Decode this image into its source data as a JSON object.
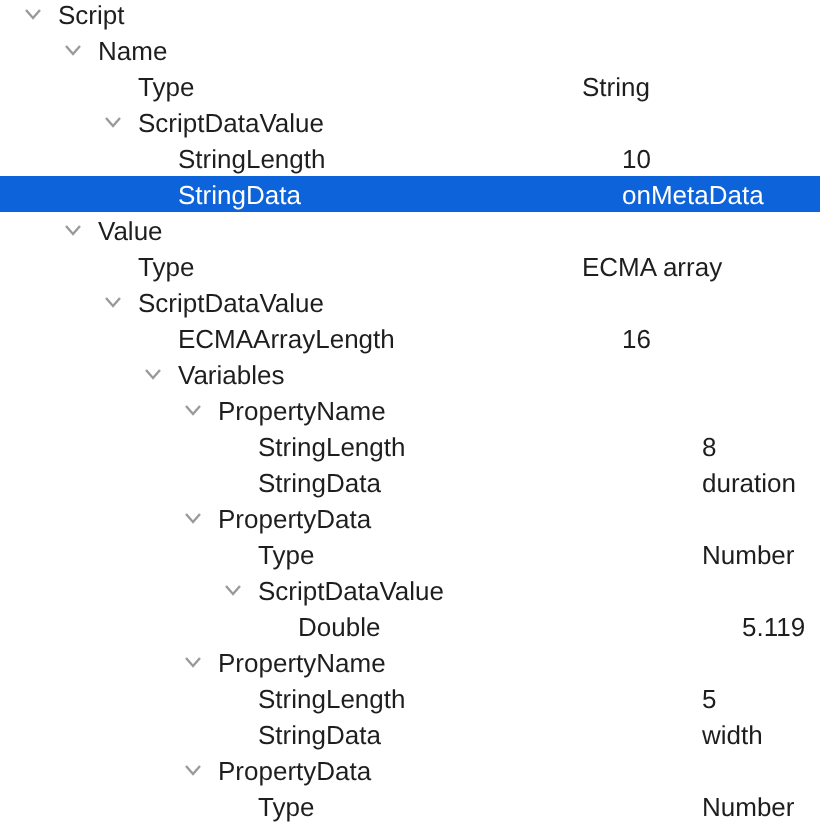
{
  "tree": [
    {
      "label": "Script",
      "expanded": true,
      "selected": false,
      "children": [
        {
          "label": "Name",
          "expanded": true,
          "selected": false,
          "children": [
            {
              "label": "Type",
              "value": "String",
              "selected": false
            },
            {
              "label": "ScriptDataValue",
              "expanded": true,
              "selected": false,
              "children": [
                {
                  "label": "StringLength",
                  "value": "10",
                  "selected": false
                },
                {
                  "label": "StringData",
                  "value": "onMetaData",
                  "selected": true
                }
              ]
            }
          ]
        },
        {
          "label": "Value",
          "expanded": true,
          "selected": false,
          "children": [
            {
              "label": "Type",
              "value": "ECMA array",
              "selected": false
            },
            {
              "label": "ScriptDataValue",
              "expanded": true,
              "selected": false,
              "children": [
                {
                  "label": "ECMAArrayLength",
                  "value": "16",
                  "selected": false
                },
                {
                  "label": "Variables",
                  "expanded": true,
                  "selected": false,
                  "children": [
                    {
                      "label": "PropertyName",
                      "expanded": true,
                      "selected": false,
                      "children": [
                        {
                          "label": "StringLength",
                          "value": "8",
                          "selected": false
                        },
                        {
                          "label": "StringData",
                          "value": "duration",
                          "selected": false
                        }
                      ]
                    },
                    {
                      "label": "PropertyData",
                      "expanded": true,
                      "selected": false,
                      "children": [
                        {
                          "label": "Type",
                          "value": "Number",
                          "selected": false
                        },
                        {
                          "label": "ScriptDataValue",
                          "expanded": true,
                          "selected": false,
                          "children": [
                            {
                              "label": "Double",
                              "value": "5.119",
                              "selected": false
                            }
                          ]
                        }
                      ]
                    },
                    {
                      "label": "PropertyName",
                      "expanded": true,
                      "selected": false,
                      "children": [
                        {
                          "label": "StringLength",
                          "value": "5",
                          "selected": false
                        },
                        {
                          "label": "StringData",
                          "value": "width",
                          "selected": false
                        }
                      ]
                    },
                    {
                      "label": "PropertyData",
                      "expanded": true,
                      "selected": false,
                      "children": [
                        {
                          "label": "Type",
                          "value": "Number",
                          "selected": false
                        }
                      ]
                    }
                  ]
                }
              ]
            }
          ]
        }
      ]
    }
  ]
}
